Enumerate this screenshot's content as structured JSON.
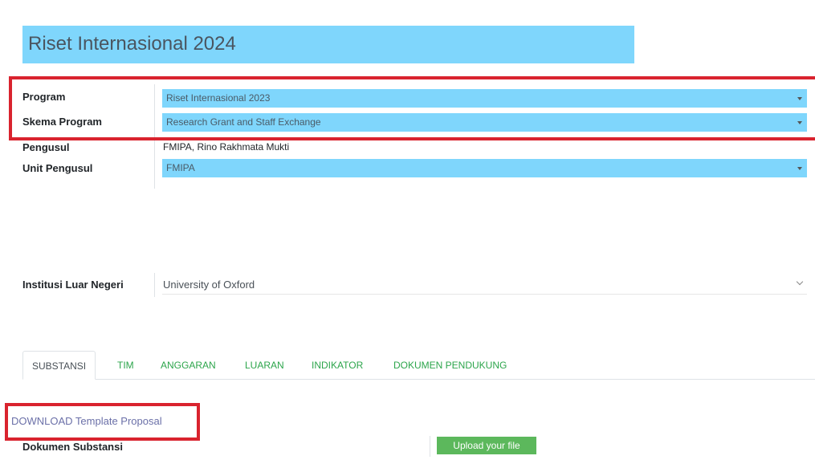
{
  "header": {
    "title": "Riset Internasional 2024"
  },
  "form": {
    "program": {
      "label": "Program",
      "value": "Riset Internasional 2023"
    },
    "skema": {
      "label": "Skema Program",
      "value": "Research Grant and Staff Exchange"
    },
    "pengusul": {
      "label": "Pengusul",
      "value": "FMIPA, Rino Rakhmata Mukti"
    },
    "unit": {
      "label": "Unit Pengusul",
      "value": "FMIPA"
    },
    "institusi": {
      "label": "Institusi Luar Negeri",
      "value": "University of Oxford"
    }
  },
  "tabs": [
    {
      "label": "SUBSTANSI",
      "active": true
    },
    {
      "label": "TIM",
      "active": false
    },
    {
      "label": "ANGGARAN",
      "active": false
    },
    {
      "label": "LUARAN",
      "active": false
    },
    {
      "label": "INDIKATOR",
      "active": false
    },
    {
      "label": "DOKUMEN PENDUKUNG",
      "active": false
    }
  ],
  "substansi": {
    "download_link": "DOWNLOAD Template Proposal",
    "doc_label": "Dokumen Substansi",
    "upload_button": "Upload your file"
  },
  "colors": {
    "field_bg": "#7fd6fc",
    "highlight": "#d9232e",
    "tab_link": "#2ca54b",
    "upload_btn": "#5cb85c"
  }
}
